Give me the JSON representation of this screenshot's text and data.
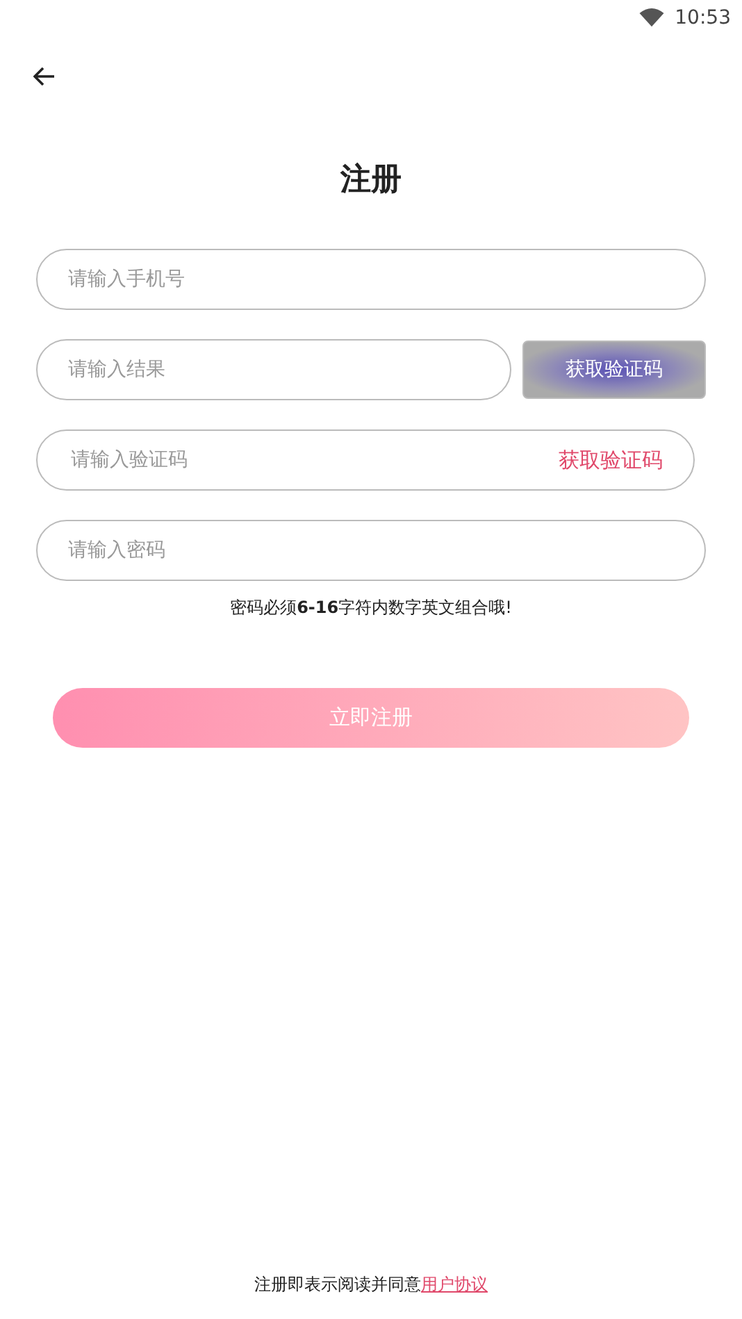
{
  "status_bar": {
    "time": "10:53"
  },
  "title": "注册",
  "fields": [
    {
      "kind": "plain",
      "placeholder": "请输入手机号"
    },
    {
      "kind": "captcha",
      "placeholder": "请输入结果",
      "button": "获取验证码"
    },
    {
      "kind": "code",
      "placeholder": "请输入验证码",
      "button": "获取验证码"
    },
    {
      "kind": "plain",
      "placeholder": "请输入密码"
    }
  ],
  "hint": "密码必须**6-16**字符内数字英文组合哦!",
  "submit": "立即注册",
  "agreement": {
    "text": "注册即表示阅读并同意",
    "link": "用户协议"
  }
}
